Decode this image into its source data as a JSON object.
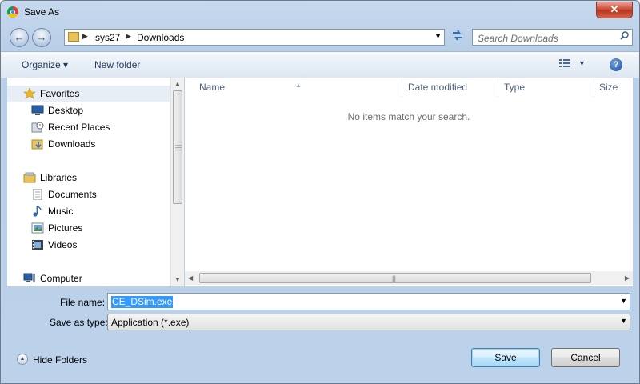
{
  "window": {
    "title": "Save As",
    "close_label": "✕"
  },
  "navigation": {
    "back_label": "←",
    "forward_label": "→",
    "breadcrumbs": [
      "sys27",
      "Downloads"
    ],
    "search_placeholder": "Search Downloads"
  },
  "toolbar": {
    "organize_label": "Organize ▾",
    "new_folder_label": "New folder",
    "help_label": "?"
  },
  "sidebar": {
    "items": [
      {
        "label": "Favorites",
        "icon": "star-icon"
      },
      {
        "label": "Desktop",
        "icon": "desktop-icon"
      },
      {
        "label": "Recent Places",
        "icon": "recent-places-icon"
      },
      {
        "label": "Downloads",
        "icon": "downloads-folder-icon"
      },
      {
        "label": "Libraries",
        "icon": "libraries-icon"
      },
      {
        "label": "Documents",
        "icon": "documents-icon"
      },
      {
        "label": "Music",
        "icon": "music-icon"
      },
      {
        "label": "Pictures",
        "icon": "pictures-icon"
      },
      {
        "label": "Videos",
        "icon": "videos-icon"
      },
      {
        "label": "Computer",
        "icon": "computer-icon"
      }
    ]
  },
  "file_list": {
    "columns": [
      "Name",
      "Date modified",
      "Type",
      "Size"
    ],
    "empty_message": "No items match your search."
  },
  "form": {
    "file_name_label": "File name:",
    "file_name_value": "CE_DSim.exe",
    "save_as_type_label": "Save as type:",
    "save_as_type_value": "Application (*.exe)"
  },
  "footer": {
    "hide_folders_label": "Hide Folders",
    "save_label": "Save",
    "cancel_label": "Cancel"
  }
}
